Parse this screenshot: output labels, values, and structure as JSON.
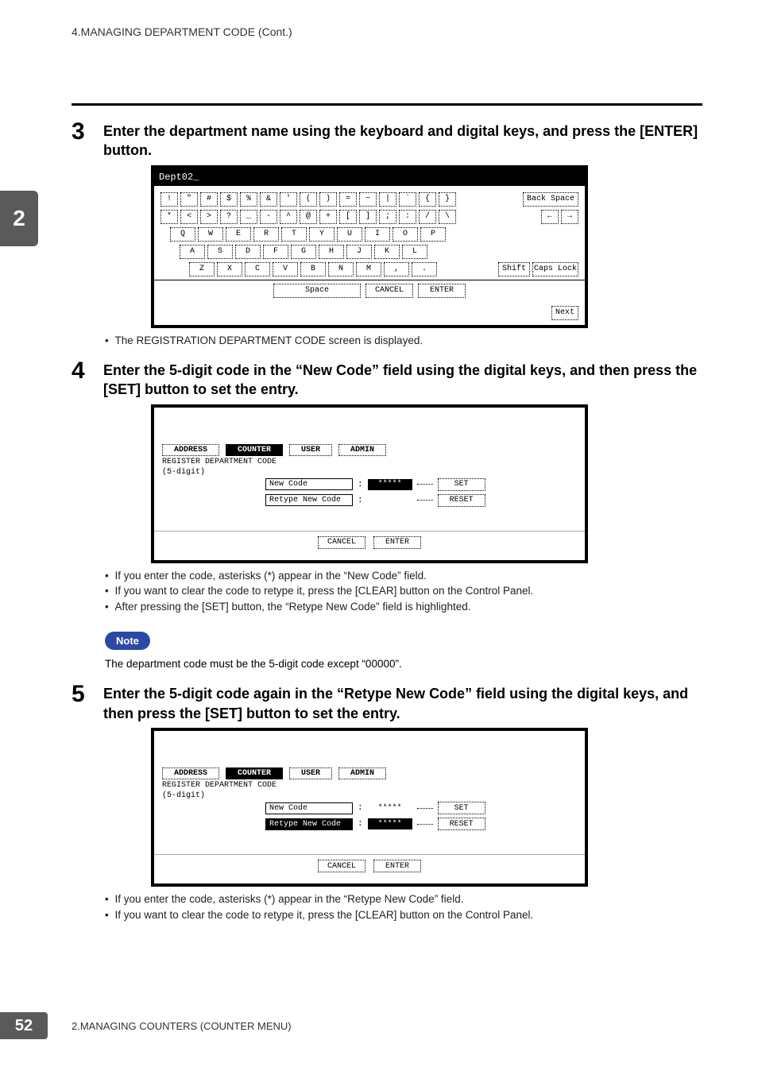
{
  "header": "4.MANAGING DEPARTMENT CODE (Cont.)",
  "side_tab": "2",
  "page_number": "52",
  "footer_text": "2.MANAGING COUNTERS (COUNTER MENU)",
  "steps": {
    "s3": {
      "num": "3",
      "text": "Enter the department name using the keyboard and digital keys, and press the [ENTER] button.",
      "bullets": [
        "The REGISTRATION DEPARTMENT CODE screen is displayed."
      ]
    },
    "s4": {
      "num": "4",
      "text": "Enter the 5-digit code in the “New Code” field using the digital keys, and then press the [SET] button to set the entry.",
      "bullets": [
        "If you enter the code, asterisks (*) appear in the “New Code” field.",
        "If you want to clear the code to retype it, press the [CLEAR] button on the Control Panel.",
        "After pressing the [SET] button, the “Retype New Code” field is highlighted."
      ]
    },
    "s5": {
      "num": "5",
      "text": "Enter the 5-digit code again in the “Retype New Code” field using the digital keys, and then press the [SET] button to set the entry.",
      "bullets": [
        "If you enter the code, asterisks (*) appear in the “Retype New Code” field.",
        "If you want to clear the code to retype it, press the [CLEAR] button on the Control Panel."
      ]
    }
  },
  "note": {
    "label": "Note",
    "text": "The department code must be the 5-digit code except “00000”."
  },
  "keyboard": {
    "title": "Dept02_",
    "row1": [
      "!",
      "\"",
      "#",
      "$",
      "%",
      "&",
      "'",
      "(",
      ")",
      "=",
      "~",
      "|",
      "`",
      "{",
      "}"
    ],
    "row2": [
      "*",
      "<",
      ">",
      "?",
      "_",
      "-",
      "^",
      "@",
      "+",
      "[",
      "]",
      ";",
      ":",
      "/",
      "\\"
    ],
    "row3": [
      "Q",
      "W",
      "E",
      "R",
      "T",
      "Y",
      "U",
      "I",
      "O",
      "P"
    ],
    "row4": [
      "A",
      "S",
      "D",
      "F",
      "G",
      "H",
      "J",
      "K",
      "L"
    ],
    "row5": [
      "Z",
      "X",
      "C",
      "V",
      "B",
      "N",
      "M",
      ",",
      "."
    ],
    "backspace": "Back Space",
    "arrow_left": "←",
    "arrow_right": "→",
    "shift": "Shift",
    "capslock": "Caps Lock",
    "space": "Space",
    "cancel": "CANCEL",
    "enter": "ENTER",
    "next": "Next"
  },
  "regscreen": {
    "tabs": {
      "address": "ADDRESS",
      "counter": "COUNTER",
      "user": "USER",
      "admin": "ADMIN"
    },
    "title1": "REGISTER DEPARTMENT CODE",
    "title2": "(5-digit)",
    "newcode_label": "New Code",
    "retype_label": "Retype New Code",
    "masked": "*****",
    "set": "SET",
    "reset": "RESET",
    "colon": ":",
    "cancel": "CANCEL",
    "enter": "ENTER"
  }
}
